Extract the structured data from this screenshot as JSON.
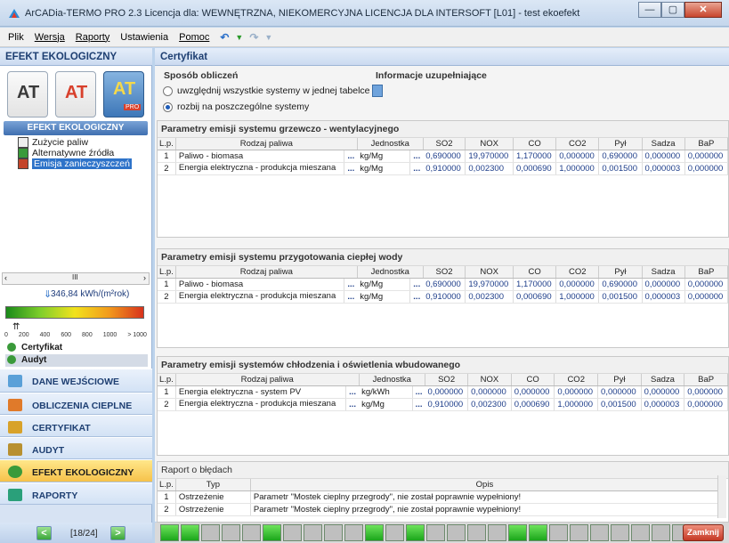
{
  "window": {
    "title": "ArCADia-TERMO PRO 2.3 Licencja dla: WEWNĘTRZNA, NIEKOMERCYJNA LICENCJA DLA INTERSOFT [L01] - test ekoefekt",
    "min": "—",
    "max": "▢",
    "close": "✕"
  },
  "menu": {
    "items": [
      "Plik",
      "Wersja",
      "Raporty",
      "Ustawienia",
      "Pomoc"
    ],
    "toolbar": [
      "↶",
      "▼",
      "↷",
      "▼"
    ]
  },
  "left": {
    "header": "EFEKT EKOLOGICZNY",
    "programs": [
      "AT",
      "AT",
      "AT"
    ],
    "pro_badge": "PRO",
    "section": "EFEKT EKOLOGICZNY",
    "tree": [
      "Zużycie paliw",
      "Alternatywne źródła",
      "Emisja zanieczyszczeń"
    ],
    "scroll_mid": "III",
    "energy_value": "346,84 kWh/(m²rok)",
    "scale": [
      "0",
      "200",
      "400",
      "600",
      "800",
      "1000",
      "> 1000"
    ],
    "marker": "⇈",
    "sub_items": [
      "Certyfikat",
      "Audyt"
    ],
    "nav": [
      "DANE WEJŚCIOWE",
      "OBLICZENIA CIEPLNE",
      "CERTYFIKAT",
      "AUDYT",
      "EFEKT EKOLOGICZNY",
      "RAPORTY"
    ],
    "pager": {
      "prev": "<",
      "text": "[18/24]",
      "next": ">"
    }
  },
  "right": {
    "header": "Certyfikat",
    "method": {
      "title": "Sposób obliczeń",
      "opt1": "uwzględnij wszystkie systemy w jednej tabelce",
      "opt2": "rozbij na poszczególne systemy",
      "selected": 2
    },
    "info": "Informacje uzupełniające",
    "columns": [
      "L.p.",
      "Rodzaj paliwa",
      "Jednostka",
      "SO2",
      "NOX",
      "CO",
      "CO2",
      "Pył",
      "Sadza",
      "BaP"
    ],
    "dots": "...",
    "tables": [
      {
        "title": "Parametry emisji systemu grzewczo - wentylacyjnego",
        "rows": [
          {
            "lp": "1",
            "fuel": "Paliwo - biomasa",
            "unit": "kg/Mg",
            "vals": [
              "0,690000",
              "19,970000",
              "1,170000",
              "0,000000",
              "0,690000",
              "0,000000",
              "0,000000"
            ]
          },
          {
            "lp": "2",
            "fuel": "Energia elektryczna - produkcja mieszana",
            "unit": "kg/Mg",
            "vals": [
              "0,910000",
              "0,002300",
              "0,000690",
              "1,000000",
              "0,001500",
              "0,000003",
              "0,000000"
            ]
          }
        ]
      },
      {
        "title": "Parametry emisji systemu przygotowania ciepłej wody",
        "rows": [
          {
            "lp": "1",
            "fuel": "Paliwo - biomasa",
            "unit": "kg/Mg",
            "vals": [
              "0,690000",
              "19,970000",
              "1,170000",
              "0,000000",
              "0,690000",
              "0,000000",
              "0,000000"
            ]
          },
          {
            "lp": "2",
            "fuel": "Energia elektryczna - produkcja mieszana",
            "unit": "kg/Mg",
            "vals": [
              "0,910000",
              "0,002300",
              "0,000690",
              "1,000000",
              "0,001500",
              "0,000003",
              "0,000000"
            ]
          }
        ]
      },
      {
        "title": "Parametry emisji systemów chłodzenia i oświetlenia wbudowanego",
        "rows": [
          {
            "lp": "1",
            "fuel": "Energia elektryczna - system PV",
            "unit": "kg/kWh",
            "vals": [
              "0,000000",
              "0,000000",
              "0,000000",
              "0,000000",
              "0,000000",
              "0,000000",
              "0,000000"
            ]
          },
          {
            "lp": "2",
            "fuel": "Energia elektryczna - produkcja mieszana",
            "unit": "kg/Mg",
            "vals": [
              "0,910000",
              "0,002300",
              "0,000690",
              "1,000000",
              "0,001500",
              "0,000003",
              "0,000000"
            ]
          }
        ]
      }
    ],
    "report": {
      "title": "Raport o błędach",
      "cols": [
        "L.p.",
        "Typ",
        "Opis"
      ],
      "rows": [
        {
          "lp": "1",
          "type": "Ostrzeżenie",
          "desc": "Parametr \"Mostek cieplny przegrody\", nie został poprawnie wypełniony!"
        },
        {
          "lp": "2",
          "type": "Ostrzeżenie",
          "desc": "Parametr \"Mostek cieplny przegrody\", nie został poprawnie wypełniony!"
        }
      ]
    }
  },
  "status": {
    "squares": [
      "g",
      "g",
      "n",
      "n",
      "n",
      "g",
      "n",
      "n",
      "n",
      "n",
      "g",
      "n",
      "g",
      "n",
      "n",
      "n",
      "n",
      "g",
      "g",
      "n",
      "n",
      "n",
      "n",
      "n",
      "n",
      "n",
      "n"
    ],
    "close": "Zamknij"
  },
  "colors": {
    "accent": "#2e73c9",
    "active": "#f6c24a",
    "ok": "#1ba61b",
    "close": "#c53a26"
  }
}
